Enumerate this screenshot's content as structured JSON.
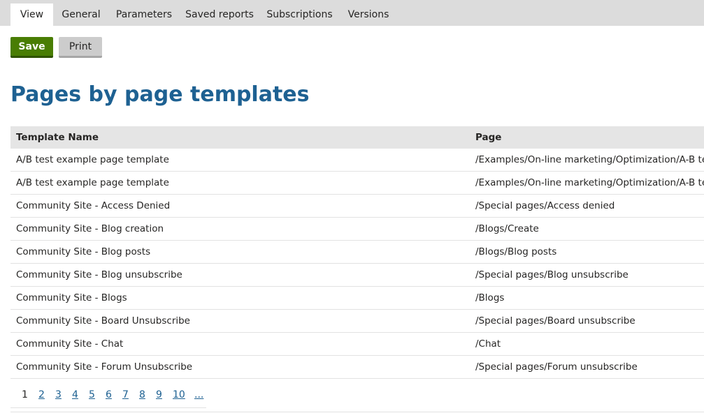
{
  "tabs": [
    {
      "label": "View",
      "active": true
    },
    {
      "label": "General",
      "active": false
    },
    {
      "label": "Parameters",
      "active": false
    },
    {
      "label": "Saved reports",
      "active": false
    },
    {
      "label": "Subscriptions",
      "active": false
    },
    {
      "label": "Versions",
      "active": false
    }
  ],
  "toolbar": {
    "save_label": "Save",
    "print_label": "Print"
  },
  "report": {
    "title": "Pages by page templates",
    "columns": [
      "Template Name",
      "Page"
    ],
    "rows": [
      [
        "A/B test example page template",
        "/Examples/On-line marketing/Optimization/A-B test"
      ],
      [
        "A/B test example page template",
        "/Examples/On-line marketing/Optimization/A-B test"
      ],
      [
        "Community Site - Access Denied",
        "/Special pages/Access denied"
      ],
      [
        "Community Site - Blog creation",
        "/Blogs/Create"
      ],
      [
        "Community Site - Blog posts",
        "/Blogs/Blog posts"
      ],
      [
        "Community Site - Blog unsubscribe",
        "/Special pages/Blog unsubscribe"
      ],
      [
        "Community Site - Blogs",
        "/Blogs"
      ],
      [
        "Community Site - Board Unsubscribe",
        "/Special pages/Board unsubscribe"
      ],
      [
        "Community Site - Chat",
        "/Chat"
      ],
      [
        "Community Site - Forum Unsubscribe",
        "/Special pages/Forum unsubscribe"
      ]
    ]
  },
  "pager": {
    "current": "1",
    "pages": [
      "1",
      "2",
      "3",
      "4",
      "5",
      "6",
      "7",
      "8",
      "9",
      "10",
      "..."
    ]
  },
  "colors": {
    "accent": "#1e6192",
    "save_button": "#497d04",
    "tab_bar": "#dcdcdc"
  }
}
